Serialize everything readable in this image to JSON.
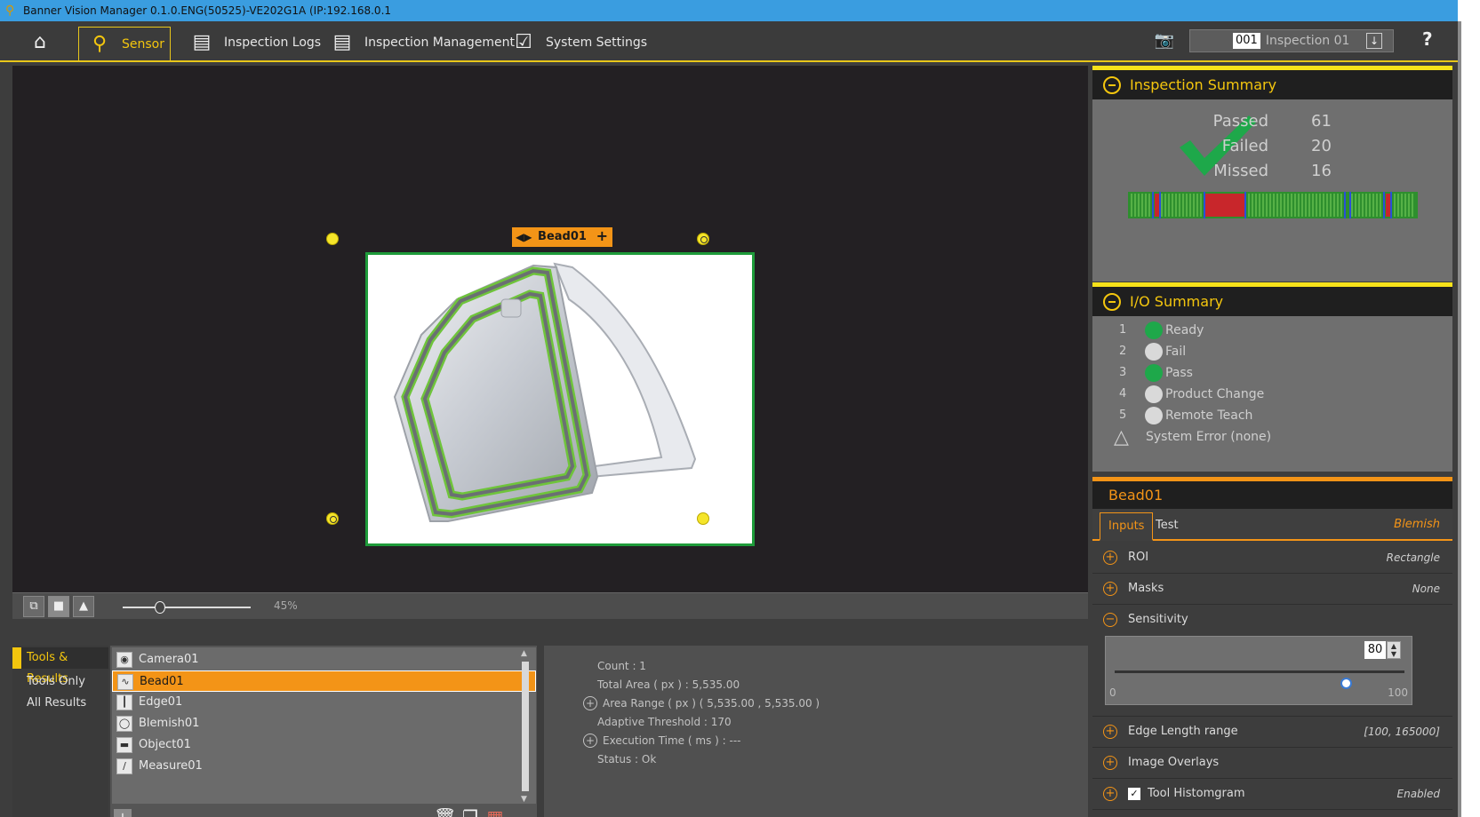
{
  "window": {
    "title": "Banner Vision Manager 0.1.0.ENG(50525)-VE202G1A (IP:192.168.0.1"
  },
  "nav": {
    "sensor": "Sensor",
    "inspection_logs": "Inspection Logs",
    "inspection_management": "Inspection Management",
    "system_settings": "System Settings"
  },
  "inspection_selector": {
    "number": "001",
    "name": "Inspection 01"
  },
  "help": "?",
  "viewer": {
    "roi_label": "Bead01"
  },
  "zoom": {
    "value_label": "45%",
    "level_percent": 45
  },
  "filters": [
    "Tools & Results",
    "Tools Only",
    "All Results"
  ],
  "tools": [
    "Camera01",
    "Bead01",
    "Edge01",
    "Blemish01",
    "Object01",
    "Measure01"
  ],
  "selected_tool": "Bead01",
  "results": {
    "count": "Count :  1",
    "total_area": "Total Area ( px ) :  5,535.00",
    "area_range": "Area Range ( px ) ( 5,535.00 , 5,535.00 )",
    "adaptive_threshold": "Adaptive Threshold :  170",
    "execution_time": "Execution Time ( ms ) :  ---",
    "status": "Status : Ok"
  },
  "inspection_summary": {
    "title": "Inspection Summary",
    "passed_label": "Passed",
    "passed": "61",
    "failed_label": "Failed",
    "failed": "20",
    "missed_label": "Missed",
    "missed": "16"
  },
  "io_summary": {
    "title": "I/O Summary",
    "rows": [
      {
        "num": "1",
        "label": "Ready",
        "state": "on"
      },
      {
        "num": "2",
        "label": "Fail",
        "state": "off"
      },
      {
        "num": "3",
        "label": "Pass",
        "state": "on"
      },
      {
        "num": "4",
        "label": "Product Change",
        "state": "off"
      },
      {
        "num": "5",
        "label": "Remote Teach",
        "state": "off"
      }
    ],
    "system_error": "System Error (none)"
  },
  "tool_panel": {
    "title": "Bead01",
    "tabs": [
      "Inputs",
      "Test"
    ],
    "tool_type": "Blemish",
    "roi_label": "ROI",
    "roi_value": "Rectangle",
    "masks_label": "Masks",
    "masks_value": "None",
    "sensitivity_label": "Sensitivity",
    "sensitivity_value": "80",
    "sensitivity_min": "0",
    "sensitivity_max": "100",
    "edge_label": "Edge Length range",
    "edge_value": "[100, 165000]",
    "overlays_label": "Image Overlays",
    "histogram_label": "Tool Histomgram",
    "histogram_value": "Enabled"
  },
  "colors": {
    "accent_yellow": "#f4c60e",
    "accent_orange": "#f39417",
    "pass_green": "#1ea84a",
    "io_off": "#d9d9d9"
  }
}
